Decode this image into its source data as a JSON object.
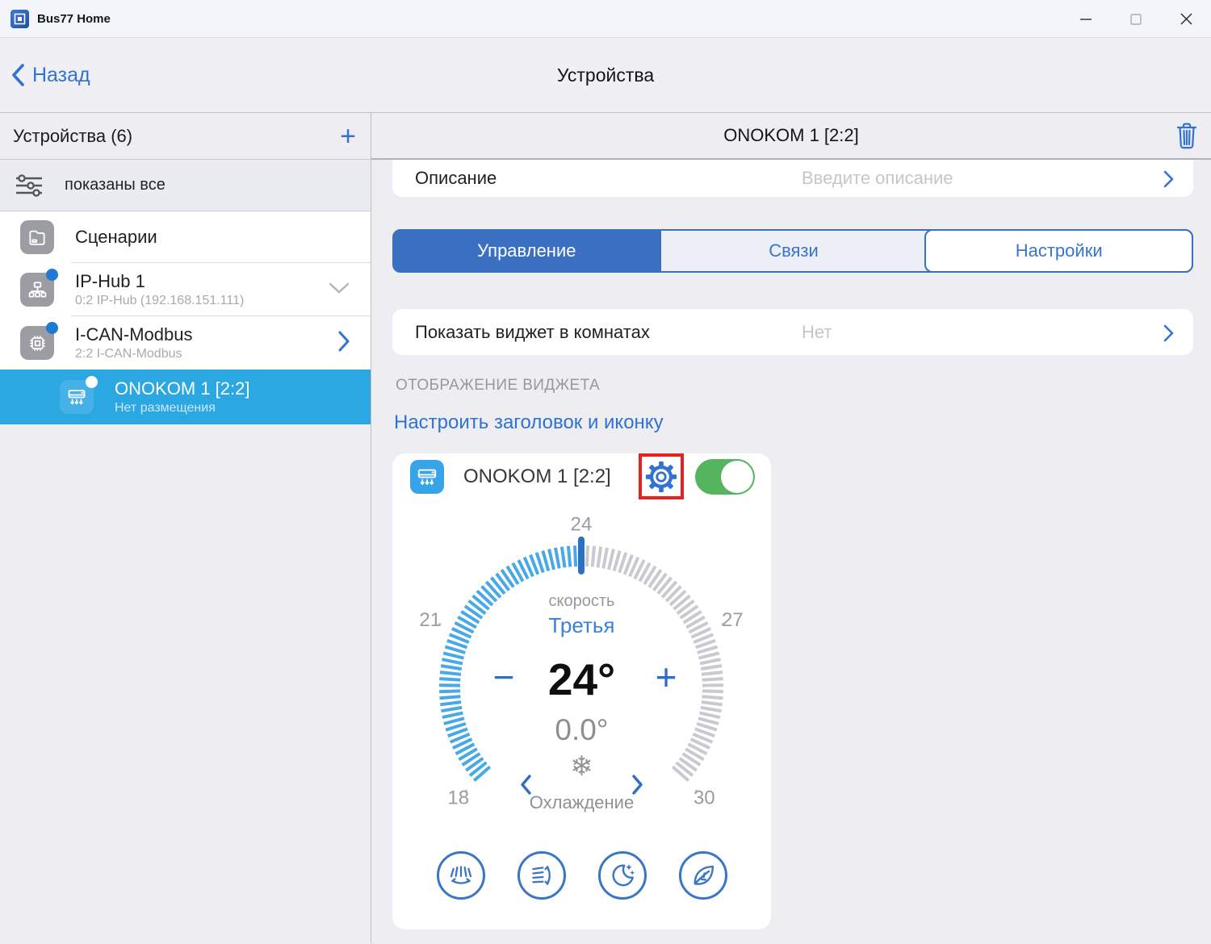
{
  "window": {
    "title": "Bus77 Home"
  },
  "nav": {
    "back_label": "Назад",
    "title": "Устройства"
  },
  "sidebar": {
    "header": {
      "title": "Устройства (6)",
      "add_label": "+"
    },
    "filter": {
      "label": "показаны все"
    },
    "items": [
      {
        "label": "Сценарии",
        "icon": "folder-icon"
      },
      {
        "label": "IP-Hub 1",
        "sublabel": "0:2 IP-Hub (192.168.151.111)",
        "icon": "hub-icon",
        "badge": true,
        "chevron": "down"
      },
      {
        "label": "I-CAN-Modbus",
        "sublabel": "2:2 I-CAN-Modbus",
        "icon": "chip-icon",
        "badge": true,
        "chevron": "right"
      },
      {
        "label": "ONOKOM 1 [2:2]",
        "sublabel": "Нет размещения",
        "icon": "ac-unit-icon",
        "badge": true,
        "selected": true
      }
    ]
  },
  "main": {
    "header": {
      "title": "ONOKOM 1 [2:2]"
    },
    "description_row": {
      "label": "Описание",
      "placeholder": "Введите описание"
    },
    "tabs": [
      {
        "label": "Управление",
        "active": true
      },
      {
        "label": "Связи",
        "active": false
      },
      {
        "label": "Настройки",
        "active": false
      }
    ],
    "widget_row": {
      "label": "Показать виджет в комнатах",
      "value": "Нет"
    },
    "section_label": "ОТОБРАЖЕНИЕ ВИДЖЕТА",
    "configure_link": "Настроить заголовок и иконку",
    "widget": {
      "title": "ONOKOM 1 [2:2]",
      "toggle_on": true,
      "speed_label": "скорость",
      "speed_value": "Третья",
      "minus_label": "−",
      "plus_label": "+",
      "setpoint": "24°",
      "current": "0.0°",
      "mode_icon": "❄",
      "mode_label": "Охлаждение",
      "gauge": {
        "min": 18,
        "max": 30,
        "value": 24,
        "span_deg": 264,
        "tick_labels": [
          "18",
          "21",
          "24",
          "27",
          "30"
        ]
      },
      "buttons": [
        "swing-horizontal",
        "swing-vertical",
        "night-mode",
        "eco-mode"
      ]
    }
  },
  "colors": {
    "accent_blue": "#3273d1",
    "segment_blue": "#3a70bf",
    "selected_sky": "#2ba7e2",
    "tick_active": "#49a9e5",
    "tick_inactive": "#c9c9ce",
    "tick_marker": "#2e6fc4",
    "toggle_green": "#55b55f",
    "annotation_red": "#e8211d"
  }
}
